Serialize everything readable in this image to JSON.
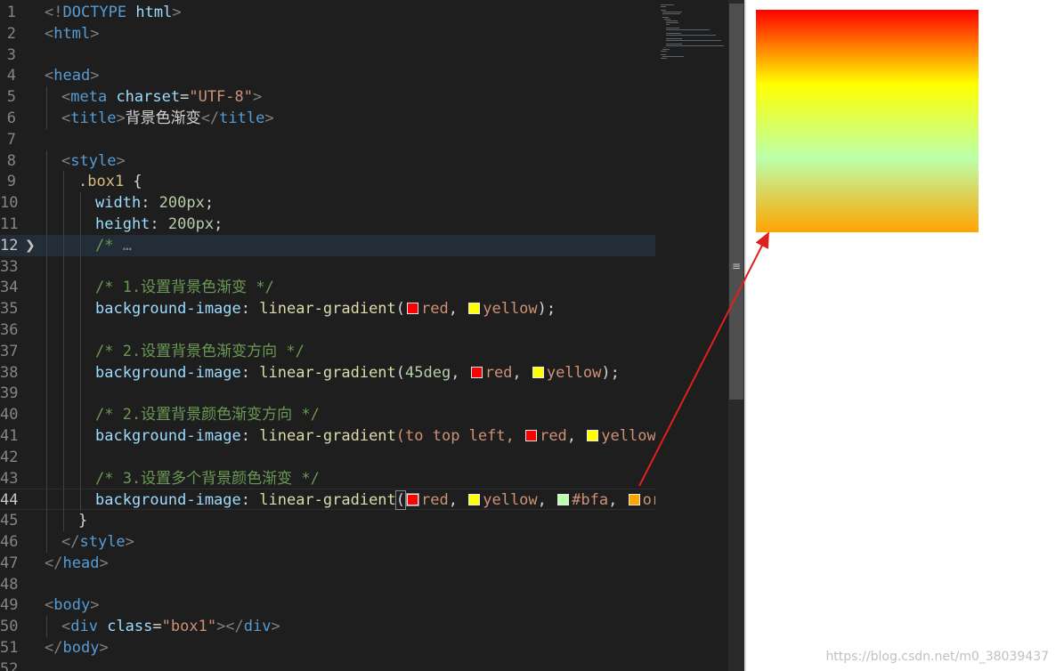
{
  "editor": {
    "lines": [
      {
        "n": "1",
        "indent": 0,
        "tokens": [
          {
            "t": "<!",
            "c": "punc"
          },
          {
            "t": "DOCTYPE ",
            "c": "tag"
          },
          {
            "t": "html",
            "c": "attr"
          },
          {
            "t": ">",
            "c": "punc"
          }
        ]
      },
      {
        "n": "2",
        "indent": 0,
        "tokens": [
          {
            "t": "<",
            "c": "punc"
          },
          {
            "t": "html",
            "c": "tag"
          },
          {
            "t": ">",
            "c": "punc"
          }
        ]
      },
      {
        "n": "3",
        "indent": 0,
        "tokens": []
      },
      {
        "n": "4",
        "indent": 0,
        "tokens": [
          {
            "t": "<",
            "c": "punc"
          },
          {
            "t": "head",
            "c": "tag"
          },
          {
            "t": ">",
            "c": "punc"
          }
        ]
      },
      {
        "n": "5",
        "indent": 1,
        "tokens": [
          {
            "t": "<",
            "c": "punc"
          },
          {
            "t": "meta ",
            "c": "tag"
          },
          {
            "t": "charset",
            "c": "attr"
          },
          {
            "t": "=",
            "c": "plain"
          },
          {
            "t": "\"UTF-8\"",
            "c": "str"
          },
          {
            "t": ">",
            "c": "punc"
          }
        ]
      },
      {
        "n": "6",
        "indent": 1,
        "tokens": [
          {
            "t": "<",
            "c": "punc"
          },
          {
            "t": "title",
            "c": "tag"
          },
          {
            "t": ">",
            "c": "punc"
          },
          {
            "t": "背景色渐变",
            "c": "plain"
          },
          {
            "t": "</",
            "c": "punc"
          },
          {
            "t": "title",
            "c": "tag"
          },
          {
            "t": ">",
            "c": "punc"
          }
        ]
      },
      {
        "n": "7",
        "indent": 0,
        "tokens": []
      },
      {
        "n": "8",
        "indent": 1,
        "tokens": [
          {
            "t": "<",
            "c": "punc"
          },
          {
            "t": "style",
            "c": "tag"
          },
          {
            "t": ">",
            "c": "punc"
          }
        ]
      },
      {
        "n": "9",
        "indent": 2,
        "tokens": [
          {
            "t": ".box1",
            "c": "sel"
          },
          {
            "t": " {",
            "c": "plain"
          }
        ]
      },
      {
        "n": "10",
        "indent": 3,
        "tokens": [
          {
            "t": "width",
            "c": "prop"
          },
          {
            "t": ": ",
            "c": "plain"
          },
          {
            "t": "200px",
            "c": "num"
          },
          {
            "t": ";",
            "c": "plain"
          }
        ]
      },
      {
        "n": "11",
        "indent": 3,
        "tokens": [
          {
            "t": "height",
            "c": "prop"
          },
          {
            "t": ": ",
            "c": "plain"
          },
          {
            "t": "200px",
            "c": "num"
          },
          {
            "t": ";",
            "c": "plain"
          }
        ]
      },
      {
        "n": "12",
        "indent": 3,
        "fold": true,
        "hl": true,
        "tokens": [
          {
            "t": "/* ",
            "c": "com"
          },
          {
            "t": "…",
            "c": "punc"
          }
        ]
      },
      {
        "n": "33",
        "indent": 3,
        "tokens": []
      },
      {
        "n": "34",
        "indent": 3,
        "tokens": [
          {
            "t": "/* 1.设置背景色渐变 */",
            "c": "com"
          }
        ]
      },
      {
        "n": "35",
        "indent": 3,
        "tokens": [
          {
            "t": "background-image",
            "c": "prop"
          },
          {
            "t": ": ",
            "c": "plain"
          },
          {
            "t": "linear-gradient",
            "c": "fn"
          },
          {
            "t": "(",
            "c": "plain"
          },
          {
            "sw": "#ff0000"
          },
          {
            "t": "red",
            "c": "kw"
          },
          {
            "t": ", ",
            "c": "plain"
          },
          {
            "sw": "#ffff00"
          },
          {
            "t": "yellow",
            "c": "kw"
          },
          {
            "t": ");",
            "c": "plain"
          }
        ]
      },
      {
        "n": "36",
        "indent": 3,
        "tokens": []
      },
      {
        "n": "37",
        "indent": 3,
        "tokens": [
          {
            "t": "/* 2.设置背景色渐变方向 */",
            "c": "com"
          }
        ]
      },
      {
        "n": "38",
        "indent": 3,
        "tokens": [
          {
            "t": "background-image",
            "c": "prop"
          },
          {
            "t": ": ",
            "c": "plain"
          },
          {
            "t": "linear-gradient",
            "c": "fn"
          },
          {
            "t": "(",
            "c": "plain"
          },
          {
            "t": "45deg",
            "c": "num"
          },
          {
            "t": ", ",
            "c": "plain"
          },
          {
            "sw": "#ff0000"
          },
          {
            "t": "red",
            "c": "kw"
          },
          {
            "t": ", ",
            "c": "plain"
          },
          {
            "sw": "#ffff00"
          },
          {
            "t": "yellow",
            "c": "kw"
          },
          {
            "t": ");",
            "c": "plain"
          }
        ]
      },
      {
        "n": "39",
        "indent": 3,
        "tokens": []
      },
      {
        "n": "40",
        "indent": 3,
        "tokens": [
          {
            "t": "/* 2.设置背景颜色渐变方向 */",
            "c": "com"
          }
        ]
      },
      {
        "n": "41",
        "indent": 3,
        "tokens": [
          {
            "t": "background-image",
            "c": "prop"
          },
          {
            "t": ": ",
            "c": "plain"
          },
          {
            "t": "linear-gradient",
            "c": "fn"
          },
          {
            "t": "(to top left, ",
            "c": "kw"
          },
          {
            "sw": "#ff0000"
          },
          {
            "t": "red",
            "c": "kw"
          },
          {
            "t": ", ",
            "c": "plain"
          },
          {
            "sw": "#ffff00"
          },
          {
            "t": "yellow",
            "c": "kw"
          },
          {
            "t": ");",
            "c": "plain"
          }
        ]
      },
      {
        "n": "42",
        "indent": 3,
        "tokens": []
      },
      {
        "n": "43",
        "indent": 3,
        "tokens": [
          {
            "t": "/* 3.设置多个背景颜色渐变 */",
            "c": "com"
          }
        ]
      },
      {
        "n": "44",
        "indent": 3,
        "active": true,
        "tokens": [
          {
            "t": "background-image",
            "c": "prop"
          },
          {
            "t": ": ",
            "c": "plain"
          },
          {
            "t": "linear-gradient",
            "c": "fn"
          },
          {
            "t": "(",
            "c": "plain",
            "hlb": true
          },
          {
            "sw": "#ff0000",
            "hlb": true
          },
          {
            "t": "red",
            "c": "kw"
          },
          {
            "t": ", ",
            "c": "plain"
          },
          {
            "sw": "#ffff00"
          },
          {
            "t": "yellow",
            "c": "kw"
          },
          {
            "t": ", ",
            "c": "plain"
          },
          {
            "sw": "#bbffaa"
          },
          {
            "t": "#bfa",
            "c": "kw"
          },
          {
            "t": ", ",
            "c": "plain"
          },
          {
            "sw": "#ffa500"
          },
          {
            "t": "orange",
            "c": "kw"
          },
          {
            "t": ");",
            "c": "plain"
          }
        ]
      },
      {
        "n": "45",
        "indent": 2,
        "tokens": [
          {
            "t": "}",
            "c": "plain"
          }
        ]
      },
      {
        "n": "46",
        "indent": 1,
        "tokens": [
          {
            "t": "</",
            "c": "punc"
          },
          {
            "t": "style",
            "c": "tag"
          },
          {
            "t": ">",
            "c": "punc"
          }
        ]
      },
      {
        "n": "47",
        "indent": 0,
        "tokens": [
          {
            "t": "</",
            "c": "punc"
          },
          {
            "t": "head",
            "c": "tag"
          },
          {
            "t": ">",
            "c": "punc"
          }
        ]
      },
      {
        "n": "48",
        "indent": 0,
        "tokens": []
      },
      {
        "n": "49",
        "indent": 0,
        "tokens": [
          {
            "t": "<",
            "c": "punc"
          },
          {
            "t": "body",
            "c": "tag"
          },
          {
            "t": ">",
            "c": "punc"
          }
        ]
      },
      {
        "n": "50",
        "indent": 1,
        "tokens": [
          {
            "t": "<",
            "c": "punc"
          },
          {
            "t": "div ",
            "c": "tag"
          },
          {
            "t": "class",
            "c": "attr"
          },
          {
            "t": "=",
            "c": "plain"
          },
          {
            "t": "\"box1\"",
            "c": "str"
          },
          {
            "t": "></",
            "c": "punc"
          },
          {
            "t": "div",
            "c": "tag"
          },
          {
            "t": ">",
            "c": "punc"
          }
        ]
      },
      {
        "n": "51",
        "indent": 0,
        "tokens": [
          {
            "t": "</",
            "c": "punc"
          },
          {
            "t": "body",
            "c": "tag"
          },
          {
            "t": ">",
            "c": "punc"
          }
        ]
      },
      {
        "n": "52",
        "indent": 0,
        "tokens": []
      }
    ]
  },
  "preview": {
    "box_gradient": [
      "#ff0000",
      "#ffff00",
      "#bbffaa",
      "#ffa500"
    ],
    "watermark": "https://blog.csdn.net/m0_38039437"
  },
  "icons": {
    "fold": "chevron-right-icon",
    "scroll_grip": "scrollbar-grip-icon"
  },
  "annotation": {
    "color": "#e0201c"
  }
}
